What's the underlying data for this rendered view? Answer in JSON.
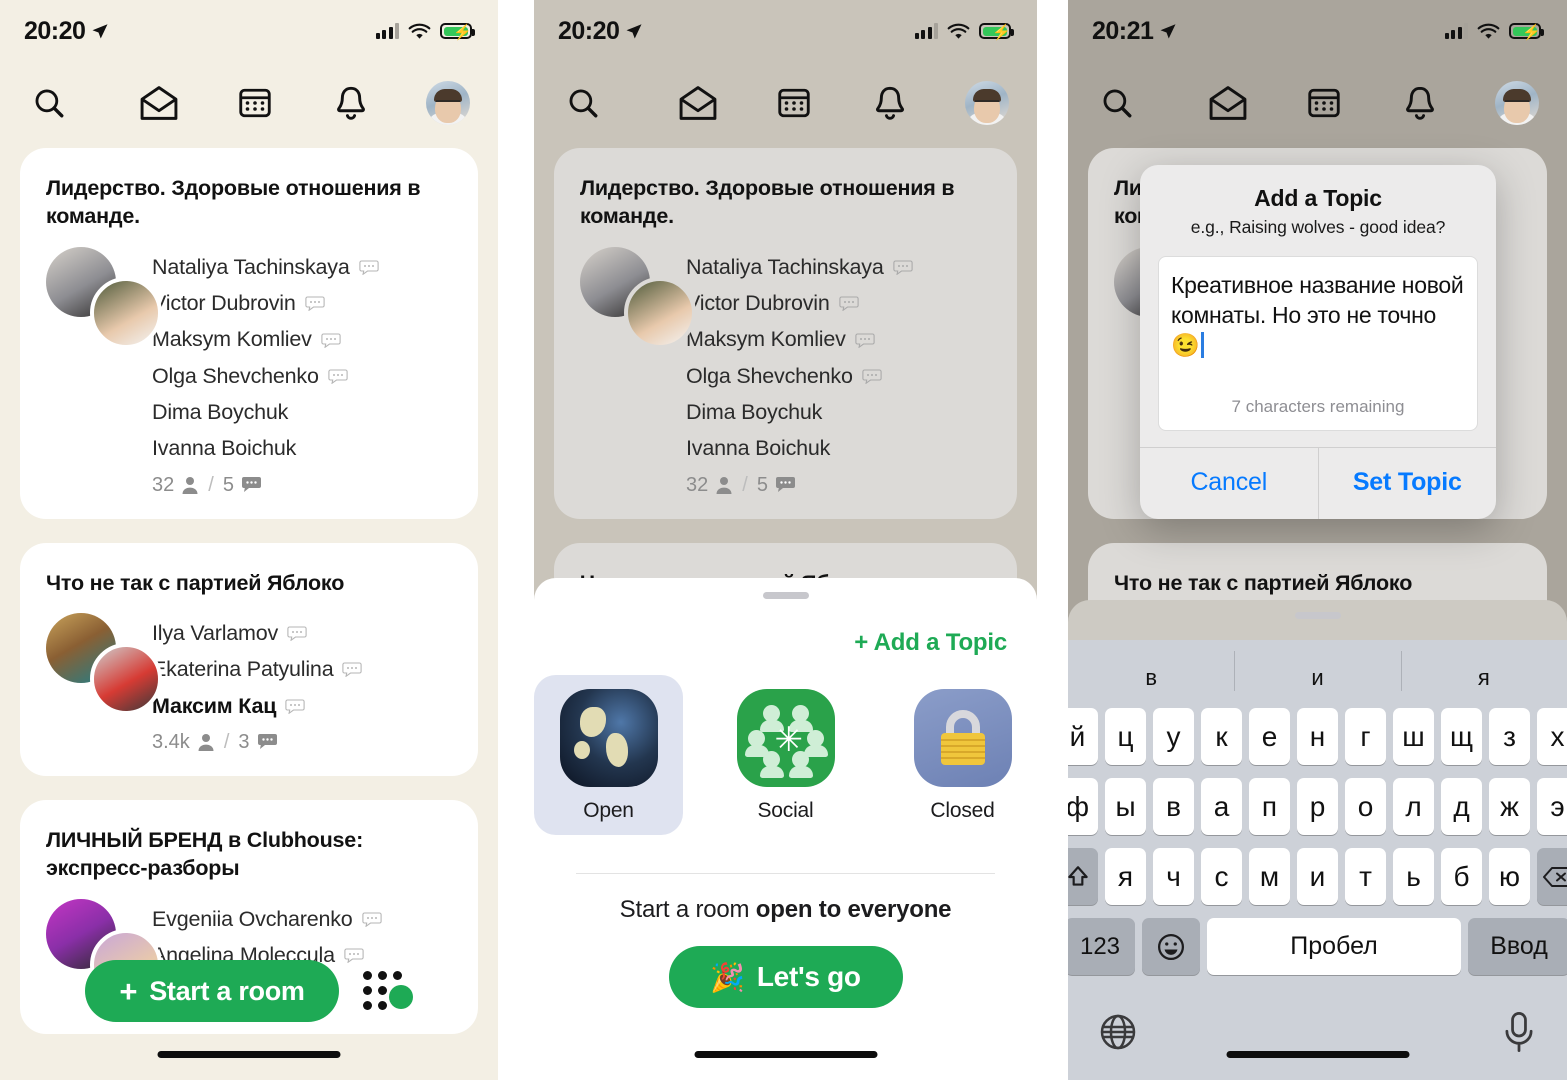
{
  "panels": [
    {
      "status": {
        "time": "20:20",
        "location_icon": "location-arrow-icon",
        "signal": "signal-bars-icon",
        "wifi": "wifi-icon",
        "battery": "battery-charging-icon"
      },
      "nav": {
        "search": "search-icon",
        "invites": "envelope-icon",
        "calendar": "calendar-icon",
        "notifications": "bell-icon",
        "profile": "avatar"
      }
    },
    {
      "status": {
        "time": "20:20"
      }
    },
    {
      "status": {
        "time": "20:21"
      }
    }
  ],
  "rooms": [
    {
      "title": "Лидерство. Здоровые отношения в команде.",
      "speakers": [
        {
          "name": "Nataliya Tachinskaya",
          "muted_icon": true,
          "bold": false
        },
        {
          "name": "Victor Dubrovin",
          "muted_icon": true,
          "bold": false
        },
        {
          "name": "Maksym Komliev",
          "muted_icon": true,
          "bold": false
        },
        {
          "name": "Olga Shevchenko",
          "muted_icon": true,
          "bold": false
        },
        {
          "name": "Dima Boychuk",
          "muted_icon": false,
          "bold": false
        },
        {
          "name": "Ivanna Boichuk",
          "muted_icon": false,
          "bold": false
        }
      ],
      "listeners": "32",
      "speaker_count": "5",
      "separator": "/"
    },
    {
      "title": "Что не так с партией Яблоко",
      "speakers": [
        {
          "name": "Ilya Varlamov",
          "muted_icon": true,
          "bold": false
        },
        {
          "name": "Ekaterina Patyulina",
          "muted_icon": true,
          "bold": false
        },
        {
          "name": "Максим Кац",
          "muted_icon": true,
          "bold": true
        }
      ],
      "listeners": "3.4k",
      "speaker_count": "3",
      "separator": "/"
    },
    {
      "title": "ЛИЧНЫЙ БРЕНД в Clubhouse: экспресс-разборы",
      "speakers": [
        {
          "name": "Evgeniia Ovcharenko",
          "muted_icon": true,
          "bold": false
        },
        {
          "name": "Angelina Moleccula",
          "muted_icon": true,
          "bold": false
        }
      ]
    }
  ],
  "start_bar": {
    "label": "Start a room",
    "plus": "+",
    "grid_icon": "grid-dots-icon"
  },
  "sheet": {
    "add_topic": "+ Add a Topic",
    "types": [
      {
        "label": "Open",
        "icon": "globe-icon",
        "selected": true
      },
      {
        "label": "Social",
        "icon": "people-group-icon",
        "selected": false
      },
      {
        "label": "Closed",
        "icon": "lock-icon",
        "selected": false
      }
    ],
    "cta_prefix": "Start a room ",
    "cta_bold": "open to everyone",
    "go_button": "Let's go",
    "go_emoji": "🎉"
  },
  "alert": {
    "title": "Add a Topic",
    "subtitle": "e.g., Raising wolves - good idea?",
    "input_value": "Креативное название новой комнаты. Но это не точно 😉",
    "chars_remaining": "7 characters remaining",
    "cancel": "Cancel",
    "confirm": "Set Topic"
  },
  "keyboard": {
    "predictions": [
      "в",
      "и",
      "я"
    ],
    "row1": [
      "й",
      "ц",
      "у",
      "к",
      "е",
      "н",
      "г",
      "ш",
      "щ",
      "з",
      "х"
    ],
    "row2": [
      "ф",
      "ы",
      "в",
      "а",
      "п",
      "р",
      "о",
      "л",
      "д",
      "ж",
      "э"
    ],
    "row3": [
      "я",
      "ч",
      "с",
      "м",
      "и",
      "т",
      "ь",
      "б",
      "ю"
    ],
    "shift": "shift-icon",
    "backspace": "backspace-icon",
    "numbers": "123",
    "emoji": "emoji-icon",
    "space": "Пробел",
    "enter": "Ввод",
    "globe": "globe-keyboard-icon",
    "mic": "microphone-icon"
  },
  "colors": {
    "accent_green": "#1eaa55",
    "ios_blue": "#067aff",
    "cream_bg": "#f3efe4"
  }
}
